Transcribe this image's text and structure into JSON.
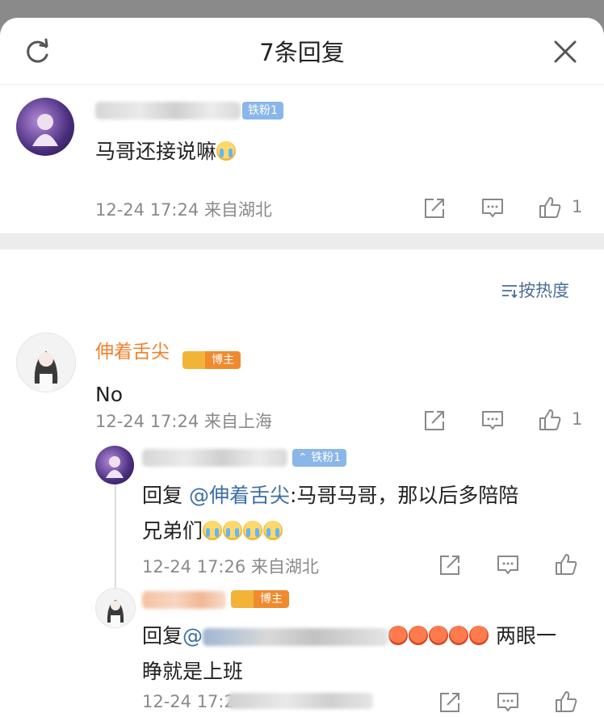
{
  "header": {
    "title": "7条回复",
    "refresh_icon": "refresh-icon",
    "close_icon": "close-icon"
  },
  "root_comment": {
    "badge": "铁粉1",
    "text": "马哥还接说嘛",
    "emoji": "crying-face",
    "time": "12-24 17:24",
    "location": "来自湖北",
    "like_count": "1"
  },
  "sort_label": "按热度",
  "reply1": {
    "username": "伸着舌尖",
    "role_badge": "博主",
    "text": "No",
    "time": "12-24 17:24",
    "location": "来自上海",
    "like_count": "1"
  },
  "reply2": {
    "badge": "铁粉1",
    "prefix": "回复 ",
    "mention": "@伸着舌尖",
    "line1_rest": ":马哥马哥，那以后多陪陪",
    "line2": "兄弟们",
    "emoji_count": 4,
    "time": "12-24 17:26",
    "location": "来自湖北"
  },
  "reply3": {
    "role_badge": "博主",
    "prefix": "回复",
    "mention_partial": "@",
    "line1_rest": "两眼一",
    "line2": "睁就是上班",
    "time_partial": "12-24 17:2"
  },
  "colors": {
    "accent_orange": "#f0802d",
    "link_blue": "#3c6ea6",
    "meta_gray": "#8a8a8a",
    "badge_blue": "#8ab6ea"
  }
}
